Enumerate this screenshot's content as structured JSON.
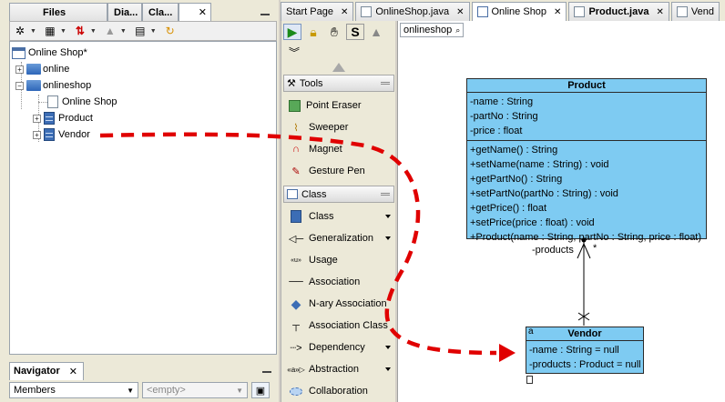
{
  "left_tabs": [
    {
      "label": "Files"
    },
    {
      "label": "Dia..."
    },
    {
      "label": "Cla..."
    },
    {
      "label": ""
    }
  ],
  "tree": {
    "root": "Online Shop*",
    "items": [
      {
        "label": "online"
      },
      {
        "label": "onlineshop"
      },
      {
        "label": "Online Shop"
      },
      {
        "label": "Product"
      },
      {
        "label": "Vendor"
      }
    ]
  },
  "navigator": {
    "title": "Navigator",
    "members_value": "Members",
    "empty_value": "<empty>"
  },
  "palette": {
    "sections": {
      "tools": "Tools",
      "class": "Class"
    },
    "tools_items": [
      {
        "label": "Point Eraser"
      },
      {
        "label": "Sweeper"
      },
      {
        "label": "Magnet"
      },
      {
        "label": "Gesture Pen"
      }
    ],
    "class_items": [
      {
        "label": "Class"
      },
      {
        "label": "Generalization"
      },
      {
        "label": "Usage"
      },
      {
        "label": "Association"
      },
      {
        "label": "N-ary Association"
      },
      {
        "label": "Association Class"
      },
      {
        "label": "Dependency"
      },
      {
        "label": "Abstraction"
      },
      {
        "label": "Collaboration"
      }
    ]
  },
  "editor_tabs": [
    {
      "label": "Start Page"
    },
    {
      "label": "OnlineShop.java"
    },
    {
      "label": "Online Shop"
    },
    {
      "label": "Product.java"
    },
    {
      "label": "Vend"
    }
  ],
  "breadcrumb": "onlineshop",
  "product_class": {
    "name": "Product",
    "attributes": [
      "-name : String",
      "-partNo : String",
      "-price : float"
    ],
    "operations": [
      "+getName() : String",
      "+setName(name : String) : void",
      "+getPartNo() : String",
      "+setPartNo(partNo : String) : void",
      "+getPrice() : float",
      "+setPrice(price : float) : void",
      "+Product(name : String, partNo : String, price : float)"
    ]
  },
  "vendor_class": {
    "name": "Vendor",
    "badge": "a",
    "attributes": [
      "-name : String = null",
      "-products : Product = null"
    ]
  },
  "association": {
    "role": "-products",
    "multiplicity": "*"
  },
  "colors": {
    "class_fill": "#7ecbf2",
    "drag_arrow": "#e00000"
  }
}
